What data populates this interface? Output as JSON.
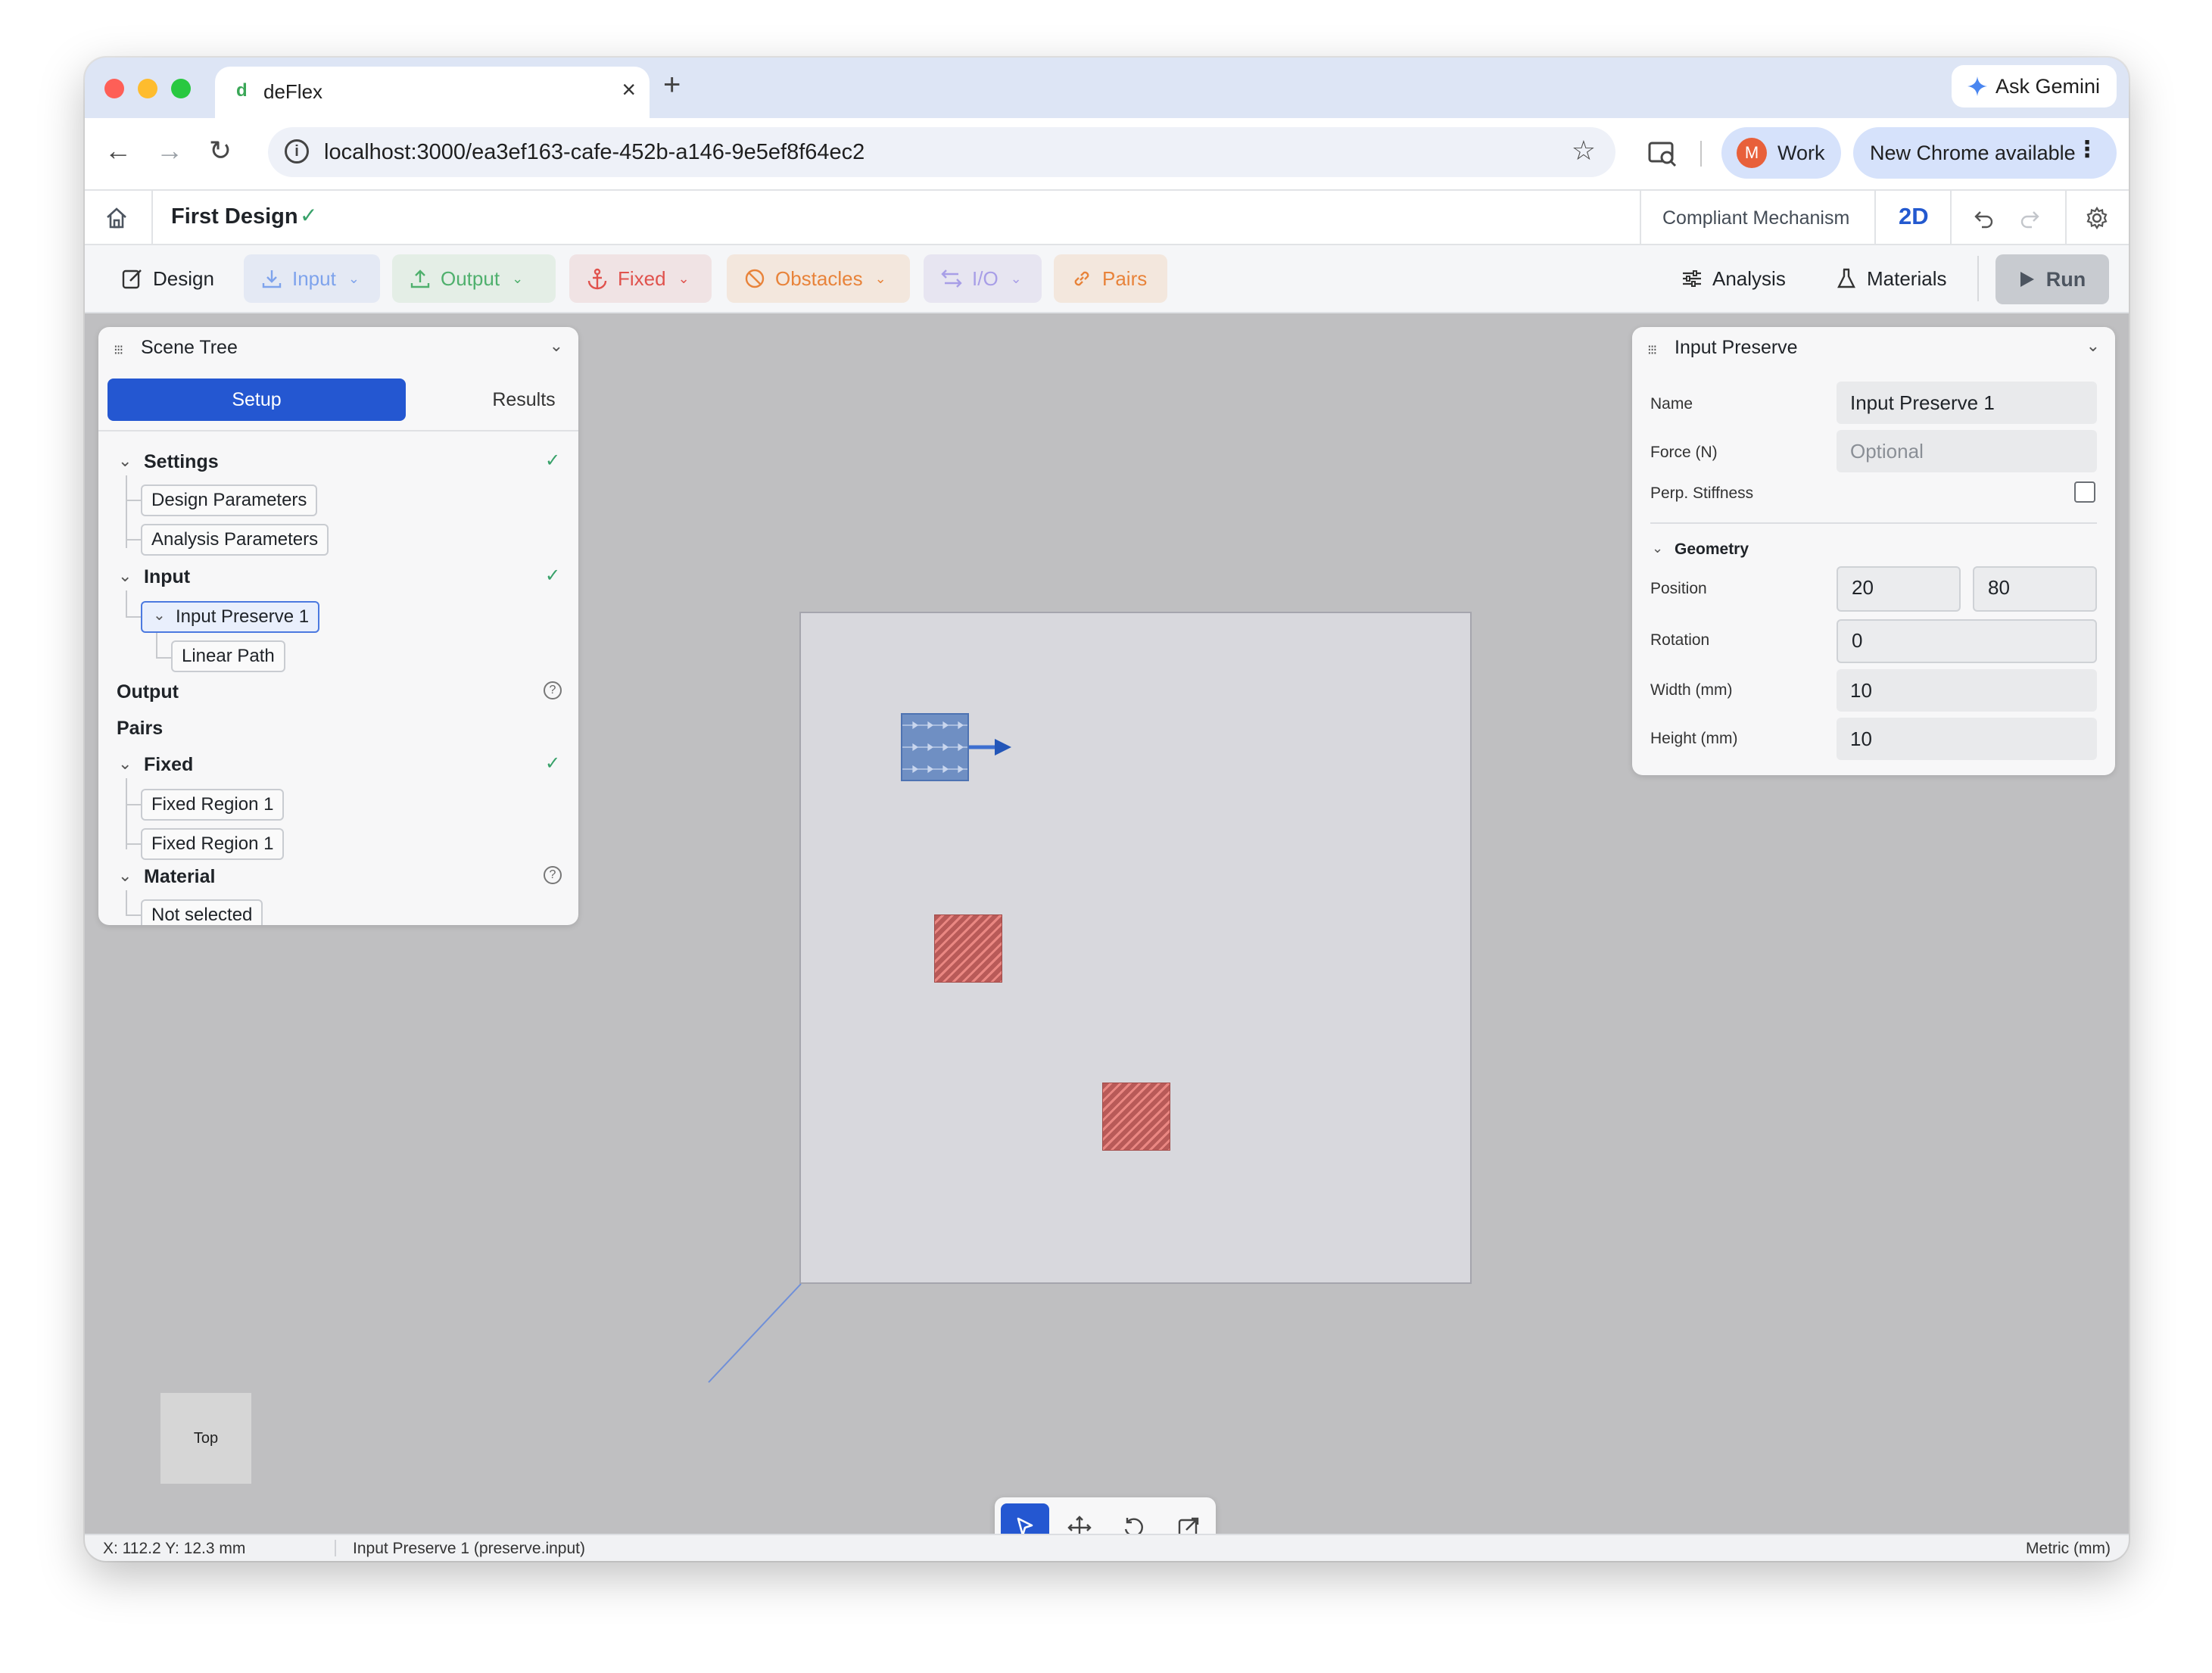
{
  "browser": {
    "tab_title": "deFlex",
    "tab_favicon": "d",
    "url": "localhost:3000/ea3ef163-cafe-452b-a146-9e5ef8f64ec2",
    "ask_gemini": "Ask Gemini",
    "profile_initial": "M",
    "profile_name": "Work",
    "update_chip": "New Chrome available"
  },
  "header": {
    "title": "First Design",
    "mode": "Compliant Mechanism",
    "view": "2D"
  },
  "ribbon": {
    "design": "Design",
    "input": "Input",
    "output": "Output",
    "fixed": "Fixed",
    "obstacles": "Obstacles",
    "io": "I/O",
    "pairs": "Pairs",
    "analysis": "Analysis",
    "materials": "Materials",
    "run": "Run"
  },
  "scene_tree": {
    "title": "Scene Tree",
    "tab_setup": "Setup",
    "tab_results": "Results",
    "settings": "Settings",
    "design_parameters": "Design Parameters",
    "analysis_parameters": "Analysis Parameters",
    "input": "Input",
    "input_preserve": "Input Preserve 1",
    "linear_path": "Linear Path",
    "output": "Output",
    "pairs": "Pairs",
    "fixed": "Fixed",
    "fixed_region_a": "Fixed Region 1",
    "fixed_region_b": "Fixed Region 1",
    "material": "Material",
    "material_value": "Not selected"
  },
  "properties": {
    "title": "Input Preserve",
    "name_label": "Name",
    "name_value": "Input Preserve 1",
    "force_label": "Force (N)",
    "force_placeholder": "Optional",
    "perp_label": "Perp. Stiffness",
    "perp_checked": false,
    "geometry_label": "Geometry",
    "position_label": "Position",
    "position_x": "20",
    "position_y": "80",
    "rotation_label": "Rotation",
    "rotation_value": "0",
    "width_label": "Width (mm)",
    "width_value": "10",
    "height_label": "Height (mm)",
    "height_value": "10"
  },
  "viewport": {
    "view_cube": "Top"
  },
  "status": {
    "coords": "X: 112.2 Y: 12.3 mm",
    "selection": "Input Preserve 1 (preserve.input)",
    "units": "Metric (mm)"
  },
  "colors": {
    "accent": "#2457d1",
    "input": "#5b8def",
    "output": "#3ba55c",
    "fixed": "#e0524d",
    "obstacles": "#e8833a",
    "io": "#8b7de0",
    "pairs": "#e8833a"
  }
}
